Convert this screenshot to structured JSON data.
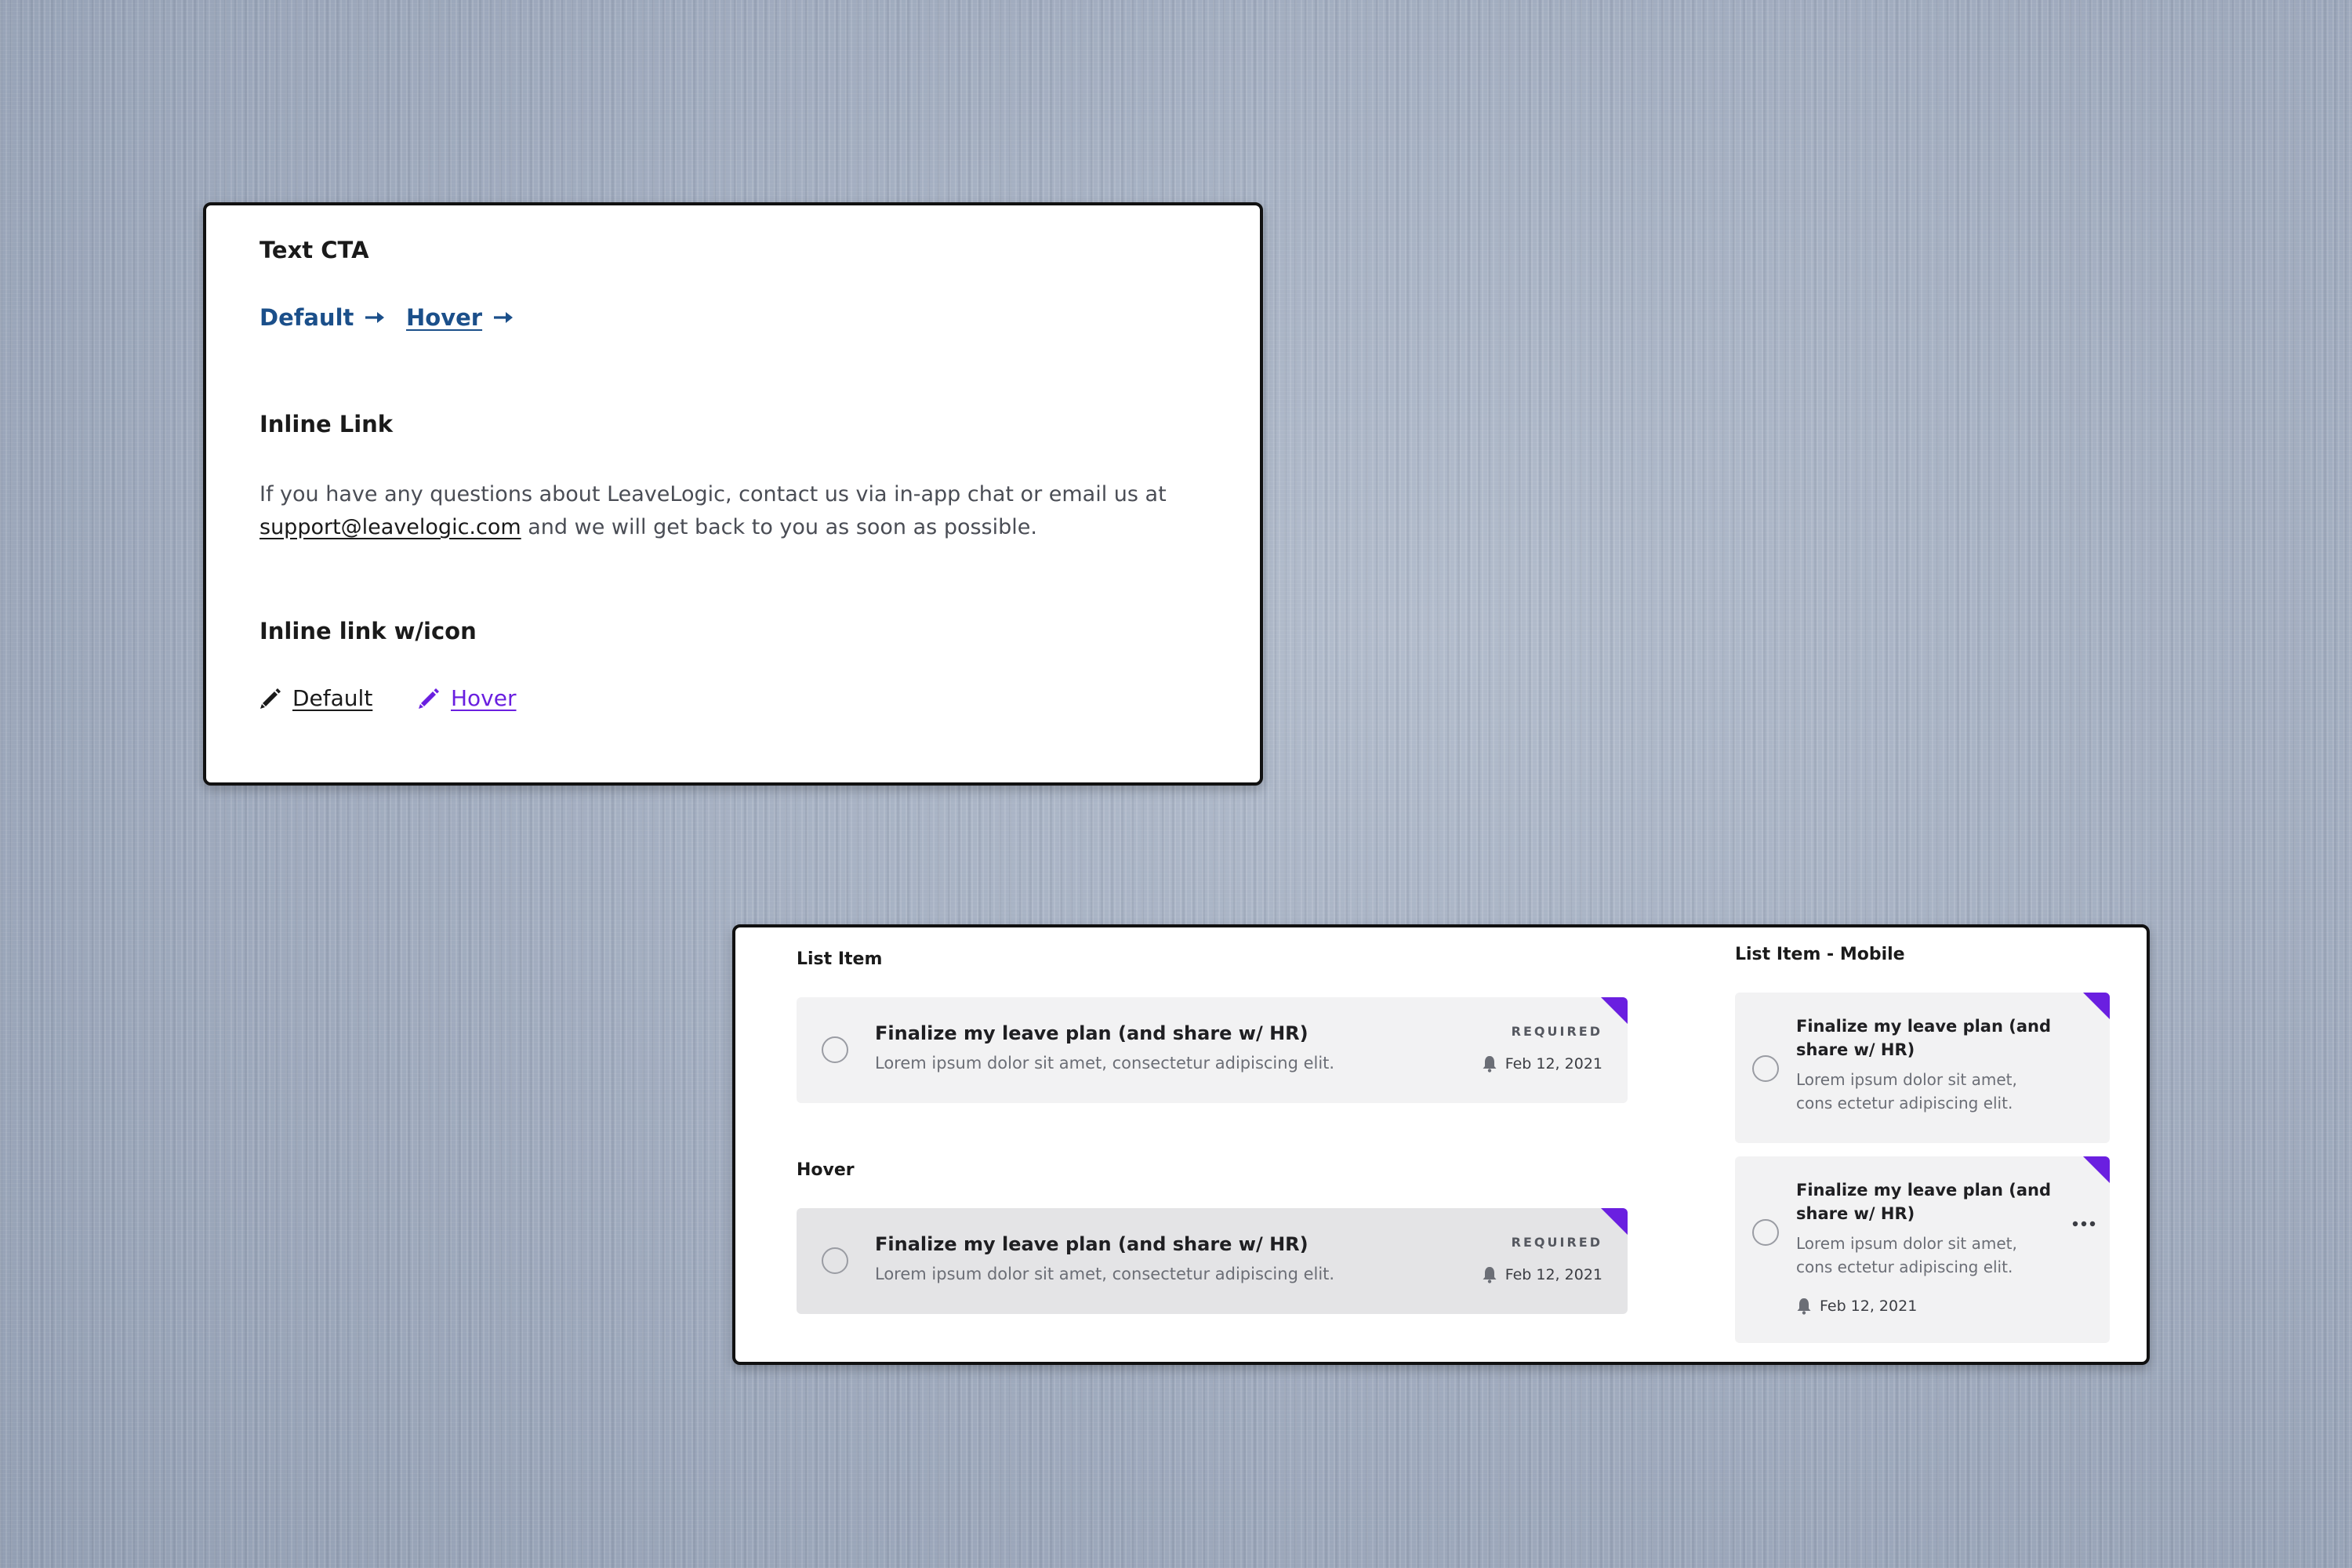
{
  "colors": {
    "background": "#a4afc1",
    "card": "#ffffff",
    "card_border": "#111111",
    "cta_link": "#1b4f8a",
    "hover_purple": "#6a1fe0",
    "accent_flag": "#6a1fe0",
    "list_item_bg": "#f2f2f3",
    "list_item_hover_bg": "#e4e4e6"
  },
  "links_card": {
    "text_cta": {
      "title": "Text CTA",
      "default_label": "Default",
      "hover_label": "Hover",
      "arrow_icon": "arrow-right-icon"
    },
    "inline_link": {
      "title": "Inline Link",
      "text_before": "If you have any questions about LeaveLogic, contact us via in-app chat or email us at ",
      "email": "support@leavelogic.com",
      "text_after": " and we will get back to you as soon as possible."
    },
    "inline_link_icon": {
      "title": "Inline link w/icon",
      "default_label": "Default",
      "hover_label": "Hover",
      "icon": "pencil-icon"
    }
  },
  "list_card": {
    "list_item_title": "List Item",
    "hover_title": "Hover",
    "mobile_title": "List Item - Mobile",
    "item": {
      "title": "Finalize my leave plan (and share w/ HR)",
      "desc": "Lorem ipsum dolor sit amet, consectetur adipiscing elit.",
      "badge": "REQUIRED",
      "date": "Feb 12, 2021",
      "date_icon": "bell-icon"
    },
    "mobile_item": {
      "title_line1": "Finalize my leave plan (and",
      "title_line2": "share w/ HR)",
      "desc_line1": "Lorem ipsum dolor sit amet,",
      "desc_line2": "cons ectetur adipiscing elit.",
      "date": "Feb 12, 2021",
      "menu_icon": "more-horizontal-icon"
    }
  }
}
